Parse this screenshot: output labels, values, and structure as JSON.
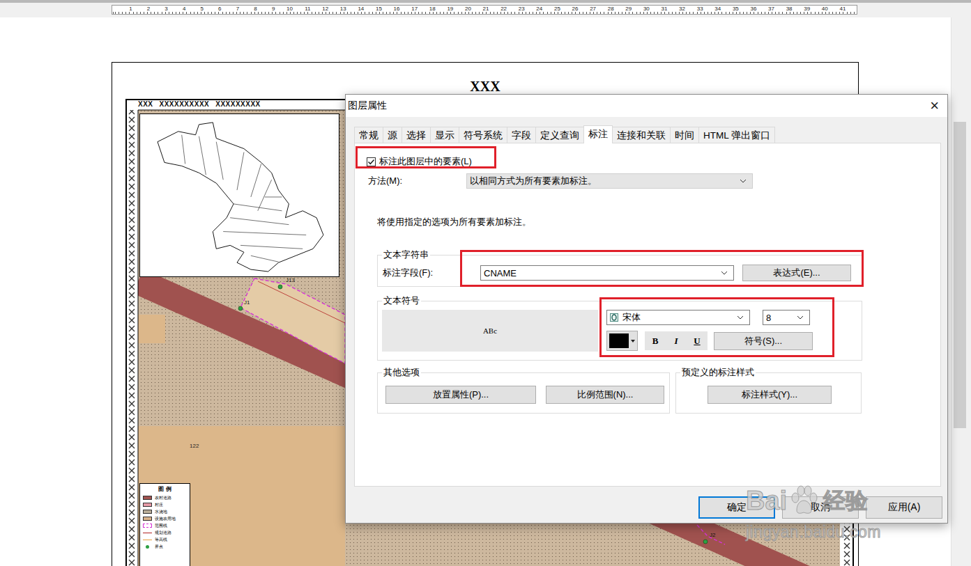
{
  "ruler": {
    "numbers": [
      "1",
      "2",
      "3",
      "4",
      "5",
      "6",
      "7",
      "8",
      "9",
      "10",
      "11",
      "12",
      "13",
      "14",
      "15",
      "16",
      "17",
      "18",
      "19",
      "20",
      "21",
      "22",
      "23",
      "24",
      "25",
      "26",
      "27",
      "28",
      "29",
      "30",
      "31",
      "32",
      "33",
      "34",
      "35",
      "36",
      "37",
      "38",
      "39",
      "40",
      "41"
    ]
  },
  "page": {
    "title": "XXX",
    "frame_text": [
      "XXX",
      "XXXXXXXXXX",
      "XXXXXXXXX"
    ]
  },
  "map": {
    "parcel_label": "122",
    "points": [
      {
        "label": "J1"
      },
      {
        "label": "J13"
      },
      {
        "label": "J2"
      }
    ]
  },
  "legend": {
    "title": "图 例",
    "items": [
      {
        "label": "农村道路",
        "kind": "fill",
        "color": "#a0524f"
      },
      {
        "label": "村庄",
        "kind": "fill",
        "color": "#e59aa6"
      },
      {
        "label": "水浇地",
        "kind": "fill",
        "color": "#b9ad98"
      },
      {
        "label": "设施农用地",
        "kind": "fill",
        "color": "#d9b28a"
      },
      {
        "label": "范围线",
        "kind": "dash",
        "color": "#d633d6"
      },
      {
        "label": "规划道路",
        "kind": "line",
        "color": "#b22222"
      },
      {
        "label": "等高线",
        "kind": "line",
        "color": "#e8a040"
      },
      {
        "label": "界点",
        "kind": "point",
        "color": "#2ea043"
      }
    ]
  },
  "dialog": {
    "title": "图层属性",
    "close": "×",
    "tabs": [
      {
        "label": "常规",
        "selected": false
      },
      {
        "label": "源",
        "selected": false
      },
      {
        "label": "选择",
        "selected": false
      },
      {
        "label": "显示",
        "selected": false
      },
      {
        "label": "符号系统",
        "selected": false
      },
      {
        "label": "字段",
        "selected": false
      },
      {
        "label": "定义查询",
        "selected": false
      },
      {
        "label": "标注",
        "selected": true
      },
      {
        "label": "连接和关联",
        "selected": false
      },
      {
        "label": "时间",
        "selected": false
      },
      {
        "label": "HTML 弹出窗口",
        "selected": false
      }
    ],
    "label_checkbox": {
      "label": "标注此图层中的要素(L)",
      "checked": true
    },
    "method": {
      "label": "方法(M):",
      "value": "以相同方式为所有要素加标注。"
    },
    "info": "将使用指定的选项为所有要素加标注。",
    "text_string": {
      "title": "文本字符串",
      "field_label": "标注字段(F):",
      "field_value": "CNAME",
      "expression_button": "表达式(E)..."
    },
    "text_symbol": {
      "title": "文本符号",
      "preview": "ABc",
      "font": "宋体",
      "size": "8",
      "color": "#000000",
      "bold": "B",
      "italic": "I",
      "underline": "U",
      "symbol_button": "符号(S)..."
    },
    "other_options": {
      "title": "其他选项",
      "buttons": [
        "放置属性(P)...",
        "比例范围(N)..."
      ]
    },
    "predefined": {
      "title": "预定义的标注样式",
      "button": "标注样式(Y)..."
    },
    "buttons": [
      {
        "label": "确定",
        "default": true
      },
      {
        "label": "取消",
        "default": false
      },
      {
        "label": "应用(A)",
        "default": false
      }
    ]
  },
  "watermark": {
    "brand": "Bai",
    "brand_cn": "经验",
    "url": "jingyan.baidu.com"
  }
}
